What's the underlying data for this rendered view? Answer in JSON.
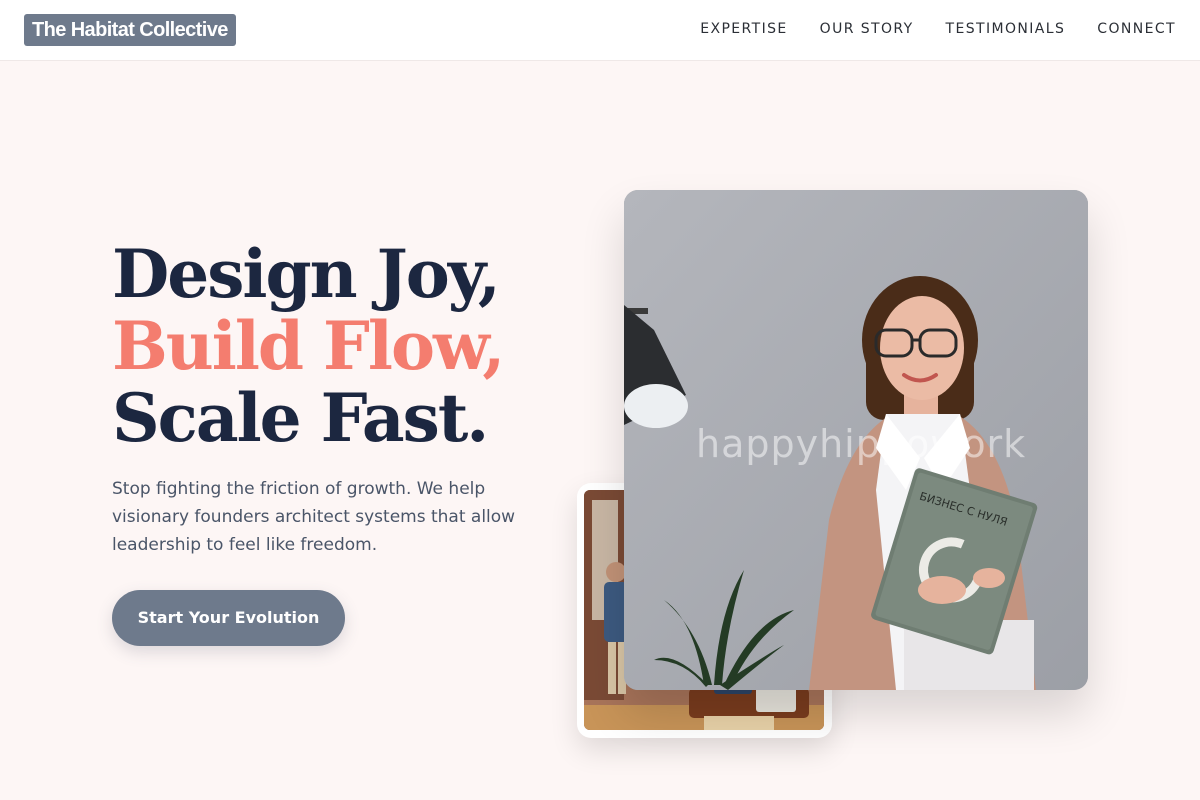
{
  "brand": {
    "logo_text": "The Habitat Collective"
  },
  "nav": {
    "items": [
      {
        "label": "EXPERTISE"
      },
      {
        "label": "OUR STORY"
      },
      {
        "label": "TESTIMONIALS"
      },
      {
        "label": "CONNECT"
      }
    ]
  },
  "hero": {
    "line1": "Design Joy,",
    "line2": "Build Flow,",
    "line3": "Scale Fast.",
    "description": "Stop fighting the friction of growth. We help visionary founders architect systems that allow leadership to feel like freedom.",
    "cta_label": "Start Your Evolution"
  },
  "images": {
    "main_watermark": "happyhippowork",
    "book_title": "БИЗНЕС С НУЛЯ"
  },
  "colors": {
    "accent": "#f47d6f",
    "navy": "#1c2740",
    "slate": "#6e7a8c",
    "background": "#fdf6f5"
  }
}
